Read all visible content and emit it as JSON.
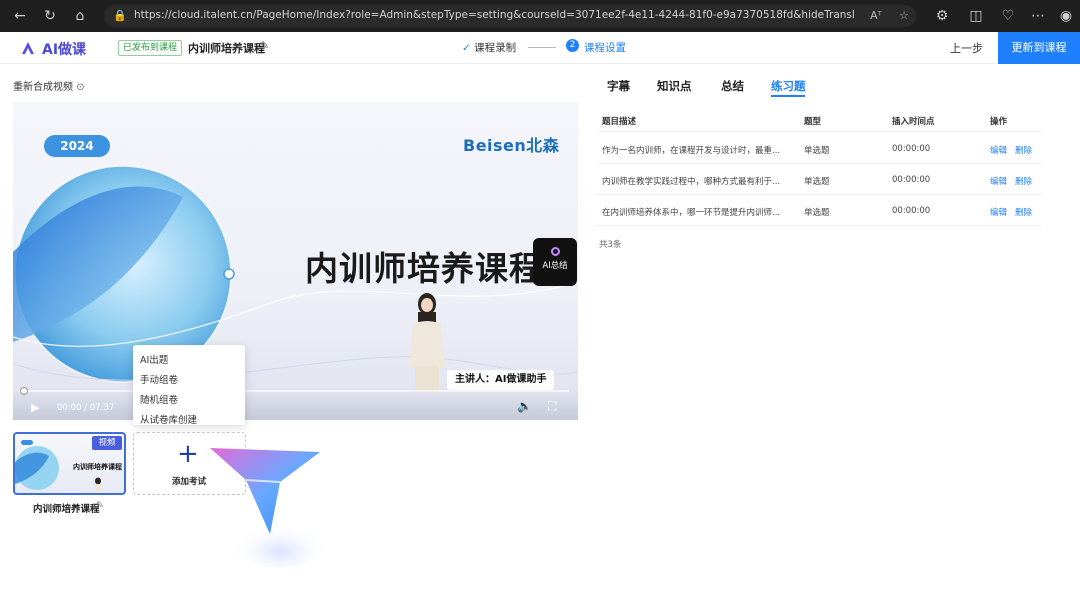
{
  "browser": {
    "url": "https://cloud.italent.cn/PageHome/Index?role=Admin&stepType=setting&courseId=3071ee2f-4e11-4244-81f0-e9a7370518fd&hideTranslationHelper=true&product...",
    "read_aloud": "Aᵀ"
  },
  "header": {
    "logo_text": "AI做课",
    "status_badge": "已发布到课程",
    "course_title": "内训师培养课程",
    "step1_label": "课程录制",
    "step2_number": "2",
    "step2_label": "课程设置",
    "prev_label": "上一步",
    "update_label": "更新到课程"
  },
  "left": {
    "regen_label": "重新合成视频",
    "player": {
      "year": "2024",
      "brand": "Beisen北森",
      "slide_title": "内训师培养课程",
      "ai_summary": "AI总结",
      "presenter": "主讲人：AI做课助手",
      "time": "00:00 / 07:37",
      "progress": 0
    },
    "menu": [
      "AI出题",
      "手动组卷",
      "随机组卷",
      "从试卷库创建"
    ],
    "thumb": {
      "badge": "视频",
      "title": "内训师培养课程",
      "caption": "内训师培养课程"
    },
    "add_label": "添加考试"
  },
  "right": {
    "tabs": [
      "字幕",
      "知识点",
      "总结",
      "练习题"
    ],
    "active_tab": "练习题",
    "columns": [
      "题目描述",
      "题型",
      "插入时间点",
      "操作"
    ],
    "rows": [
      {
        "desc": "作为一名内训师，在课程开发与设计时，最重...",
        "type": "单选题",
        "time": "00:00:00",
        "edit": "编辑",
        "delete": "删除"
      },
      {
        "desc": "内训师在教学实践过程中，哪种方式最有利于...",
        "type": "单选题",
        "time": "00:00:00",
        "edit": "编辑",
        "delete": "删除"
      },
      {
        "desc": "在内训师培养体系中，哪一环节是提升内训师...",
        "type": "单选题",
        "time": "00:00:00",
        "edit": "编辑",
        "delete": "删除"
      }
    ],
    "total": "共3条"
  },
  "colors": {
    "primary": "#1e80ff",
    "logo": "#4a4ad8",
    "badge_green": "#2d9a48"
  }
}
